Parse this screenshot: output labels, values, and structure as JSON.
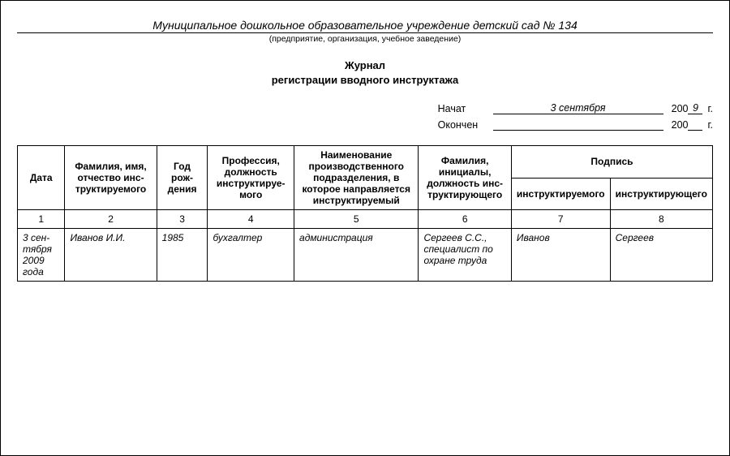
{
  "org": {
    "name": "Муниципальное дошкольное образовательное учреждение детский сад № 134",
    "hint": "(предприятие, организация, учебное заведение)"
  },
  "title": {
    "l1": "Журнал",
    "l2": "регистрации вводного инструктажа"
  },
  "dates": {
    "start_label": "Начат",
    "end_label": "Окончен",
    "century_prefix": "200",
    "tail": "г.",
    "start_value": "3 сентября",
    "start_year_suffix": "9",
    "end_value": "",
    "end_year_suffix": ""
  },
  "headers": {
    "c1": "Дата",
    "c2": "Фамилия, имя, отчество инс­труктируемого",
    "c3": "Год рож­дения",
    "c4": "Профессия, должность инструктируе­мого",
    "c5": "Наименование производственного подразделения, в которое направляется инструктируемый",
    "c6": "Фамилия, инициалы, должность инс­труктирующего",
    "sig": "Подпись",
    "c7": "инструктируемого",
    "c8": "инструктирующего"
  },
  "colnums": {
    "1": "1",
    "2": "2",
    "3": "3",
    "4": "4",
    "5": "5",
    "6": "6",
    "7": "7",
    "8": "8"
  },
  "row": {
    "c1": "3 сен­тября 2009 года",
    "c2": "Иванов И.И.",
    "c3": "1985",
    "c4": "бухгалтер",
    "c5": "администрация",
    "c6": "Сергеев С.С., специалист по охране труда",
    "c7": "Иванов",
    "c8": "Сергеев"
  }
}
